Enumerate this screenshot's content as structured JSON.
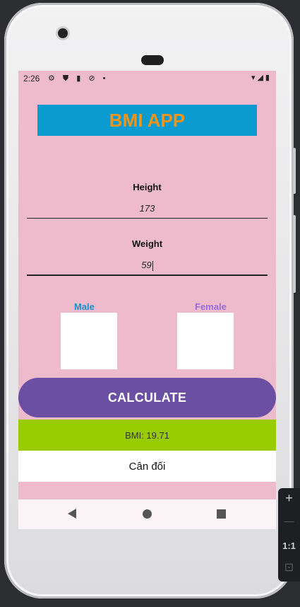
{
  "status_bar": {
    "time": "2:26",
    "left_icons": "⚙ ⛊ ▮ ⊘ •",
    "right_icons": "▾◢▮"
  },
  "app": {
    "title": "BMI APP",
    "colors": {
      "background": "#eebbcc",
      "title_bg": "#0a9bd1",
      "title_text": "#f29419",
      "button": "#6b4fa3",
      "result_bar": "#99cc00",
      "male_label": "#1a8fd0",
      "female_label": "#9b6bdd"
    }
  },
  "height": {
    "label": "Height",
    "value": "173"
  },
  "weight": {
    "label": "Weight",
    "value": "59"
  },
  "gender": {
    "male_label": "Male",
    "female_label": "Female"
  },
  "calculate_label": "CALCULATE",
  "result": {
    "bmi_text": "BMI: 19.71",
    "status_text": "Cân đối"
  },
  "emulator_toolbar": {
    "zoom_in": "+",
    "zoom_out": "—",
    "ratio": "1:1",
    "fit": "⊡"
  }
}
